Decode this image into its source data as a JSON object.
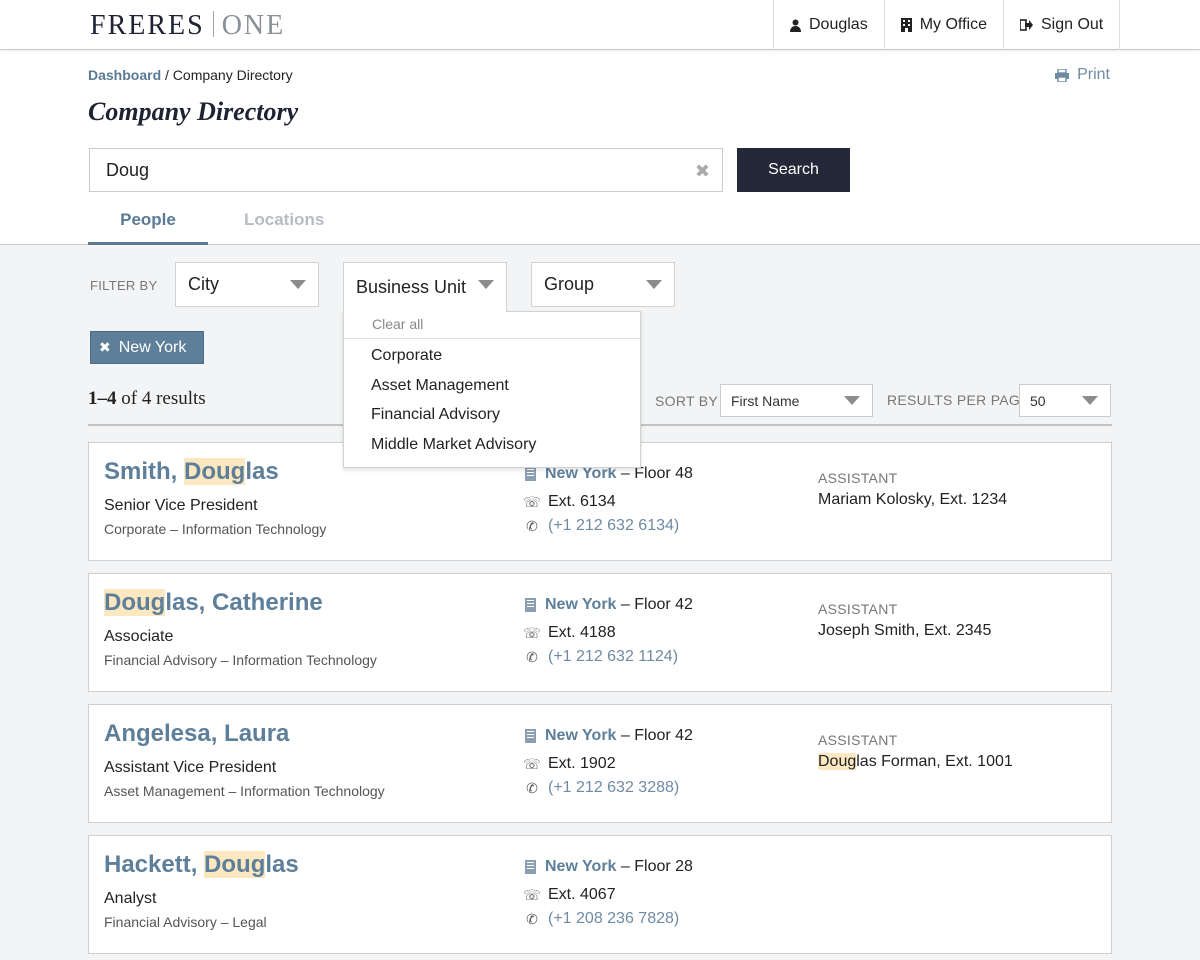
{
  "brand": {
    "left": "FRERES",
    "right": "ONE"
  },
  "topnav": [
    {
      "label": "Douglas",
      "icon": "user-icon"
    },
    {
      "label": "My Office",
      "icon": "building-icon"
    },
    {
      "label": "Sign Out",
      "icon": "sign-out-icon"
    }
  ],
  "breadcrumb": {
    "home": "Dashboard",
    "separator": "/",
    "current": "Company Directory"
  },
  "print_label": "Print",
  "page_title": "Company Directory",
  "search": {
    "value": "Doug",
    "button": "Search"
  },
  "tabs": [
    {
      "label": "People",
      "active": true
    },
    {
      "label": "Locations",
      "active": false
    }
  ],
  "filter": {
    "label": "FILTER BY",
    "city": "City",
    "business_unit": "Business Unit",
    "group": "Group",
    "dropdown": {
      "clear": "Clear all",
      "options": [
        "Corporate",
        "Asset Management",
        "Financial Advisory",
        "Middle Market Advisory"
      ]
    },
    "chip": "New York"
  },
  "results": {
    "range": "1–4",
    "of": "of",
    "total": "4",
    "word": "results"
  },
  "sort": {
    "label": "SORT BY",
    "value": "First Name"
  },
  "per_page": {
    "label": "RESULTS PER PAGE",
    "value": "50"
  },
  "people": [
    {
      "name_pre": "Smith, ",
      "name_hl": "Doug",
      "name_post": "las",
      "title": "Senior Vice President",
      "dept": "Corporate – Information Technology",
      "city": "New York",
      "floor": "– Floor 48",
      "ext": "Ext. 6134",
      "phone": "(+1 212 632 6134)",
      "assistant_label": "ASSISTANT",
      "assistant_pre": "",
      "assistant_hl": "",
      "assistant_post": "Mariam Kolosky, Ext. 1234"
    },
    {
      "name_pre": "",
      "name_hl": "Doug",
      "name_post": "las, Catherine",
      "title": "Associate",
      "dept": "Financial Advisory – Information Technology",
      "city": "New York",
      "floor": "– Floor 42",
      "ext": "Ext. 4188",
      "phone": "(+1 212 632 1124)",
      "assistant_label": "ASSISTANT",
      "assistant_pre": "",
      "assistant_hl": "",
      "assistant_post": "Joseph Smith, Ext. 2345"
    },
    {
      "name_pre": "Angelesa, Laura",
      "name_hl": "",
      "name_post": "",
      "title": "Assistant Vice President",
      "dept": "Asset Management – Information Technology",
      "city": "New York",
      "floor": "– Floor 42",
      "ext": "Ext. 1902",
      "phone": "(+1 212 632 3288)",
      "assistant_label": "ASSISTANT",
      "assistant_pre": "",
      "assistant_hl": "Doug",
      "assistant_post": "las Forman, Ext. 1001"
    },
    {
      "name_pre": "Hackett, ",
      "name_hl": "Doug",
      "name_post": "las",
      "title": "Analyst",
      "dept": "Financial Advisory – Legal",
      "city": "New York",
      "floor": "– Floor 28",
      "ext": "Ext. 4067",
      "phone": "(+1 208 236 7828)",
      "assistant_label": "",
      "assistant_pre": "",
      "assistant_hl": "",
      "assistant_post": ""
    }
  ]
}
